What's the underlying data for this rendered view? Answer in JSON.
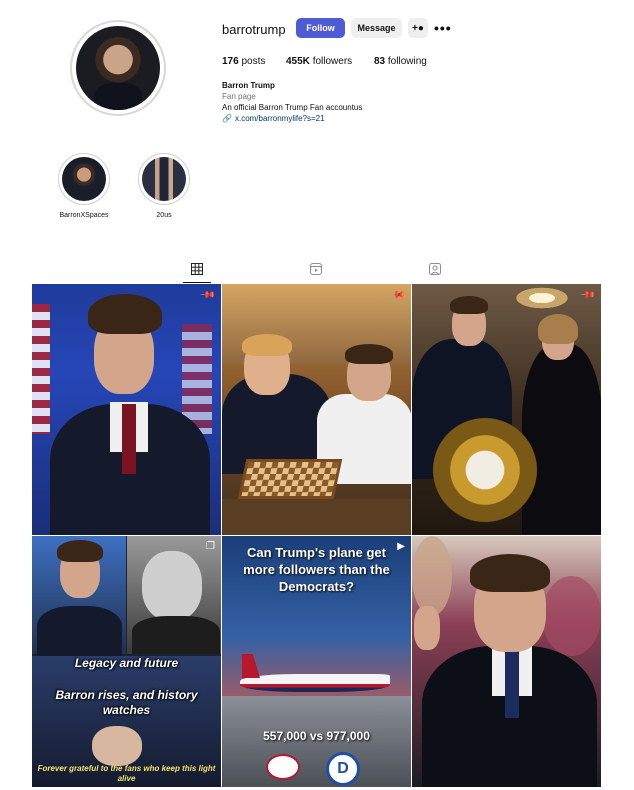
{
  "profile": {
    "username": "barrotrump",
    "follow_label": "Follow",
    "message_label": "Message",
    "add_user_icon": "add-user-icon",
    "more_icon": "more-options-icon",
    "stats": {
      "posts_value": "176",
      "posts_label": "posts",
      "followers_value": "455K",
      "followers_label": "followers",
      "following_value": "83",
      "following_label": "following"
    },
    "full_name": "Barron Trump",
    "category": "Fan page",
    "bio": "An official Barron Trump Fan accountus",
    "link": "x.com/barronmylife?s=21"
  },
  "highlights": [
    {
      "label": "BarronXSpaces"
    },
    {
      "label": "20us"
    }
  ],
  "tabs": [
    {
      "icon": "grid-icon",
      "active": true
    },
    {
      "icon": "reels-icon",
      "active": false
    },
    {
      "icon": "tagged-icon",
      "active": false
    }
  ],
  "posts": {
    "p4": {
      "title1": "Legacy and future",
      "title2": "Barron rises, and history watches",
      "caption": "Forever grateful to the fans who keep this light alive"
    },
    "p5": {
      "title": "Can Trump's plane get more followers than the Democrats?",
      "score": "557,000 vs 977,000"
    }
  },
  "colors": {
    "follow_button": "#4f5bd5",
    "link": "#00376b"
  }
}
